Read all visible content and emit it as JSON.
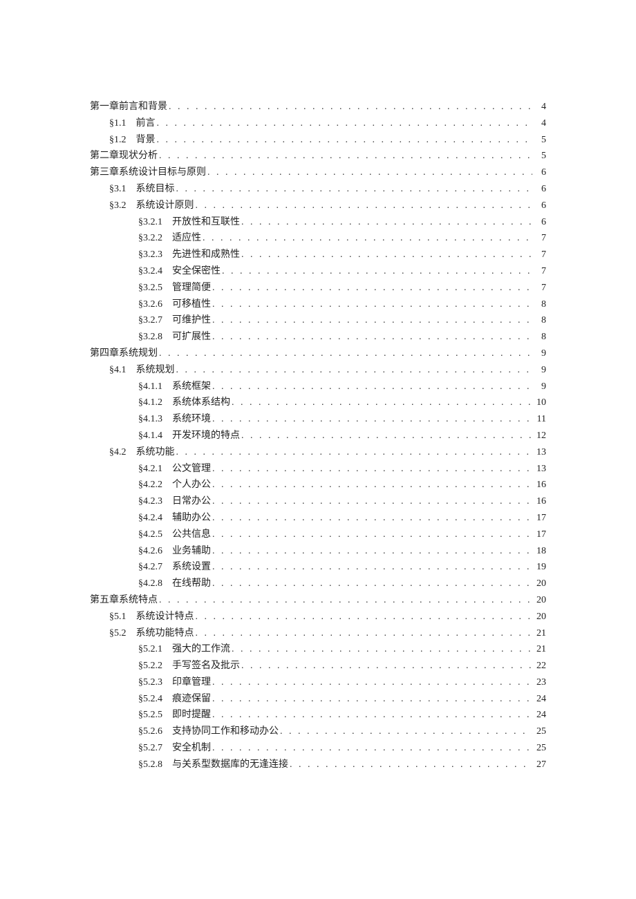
{
  "toc": [
    {
      "indent": 0,
      "num": "",
      "title": "第一章前言和背景",
      "page": "4"
    },
    {
      "indent": 1,
      "num": "§1.1",
      "title": "前言",
      "page": "4"
    },
    {
      "indent": 1,
      "num": "§1.2",
      "title": "背景",
      "page": "5"
    },
    {
      "indent": 0,
      "num": "",
      "title": "第二章现状分析",
      "page": "5"
    },
    {
      "indent": 0,
      "num": "",
      "title": "第三章系统设计目标与原则",
      "page": "6"
    },
    {
      "indent": 1,
      "num": "§3.1",
      "title": "系统目标",
      "page": "6"
    },
    {
      "indent": 1,
      "num": "§3.2",
      "title": "系统设计原则",
      "page": "6"
    },
    {
      "indent": 2,
      "num": "§3.2.1",
      "title": "开放性和互联性",
      "page": "6"
    },
    {
      "indent": 2,
      "num": "§3.2.2",
      "title": "适应性",
      "page": "7"
    },
    {
      "indent": 2,
      "num": "§3.2.3",
      "title": "先进性和成熟性",
      "page": "7"
    },
    {
      "indent": 2,
      "num": "§3.2.4",
      "title": "安全保密性",
      "page": "7"
    },
    {
      "indent": 2,
      "num": "§3.2.5",
      "title": "管理简便",
      "page": "7"
    },
    {
      "indent": 2,
      "num": "§3.2.6",
      "title": "可移植性",
      "page": "8"
    },
    {
      "indent": 2,
      "num": "§3.2.7",
      "title": "可维护性",
      "page": "8"
    },
    {
      "indent": 2,
      "num": "§3.2.8",
      "title": "可扩展性",
      "page": "8"
    },
    {
      "indent": 0,
      "num": "",
      "title": "第四章系统规划",
      "page": "9"
    },
    {
      "indent": 1,
      "num": "§4.1",
      "title": "系统规划",
      "page": "9"
    },
    {
      "indent": 2,
      "num": "§4.1.1",
      "title": "系统框架",
      "page": "9"
    },
    {
      "indent": 2,
      "num": "§4.1.2",
      "title": "系统体系结构",
      "page": "10"
    },
    {
      "indent": 2,
      "num": "§4.1.3",
      "title": "系统环境",
      "page": "11"
    },
    {
      "indent": 2,
      "num": "§4.1.4",
      "title": "开发环境的特点",
      "page": "12"
    },
    {
      "indent": 1,
      "num": "§4.2",
      "title": "系统功能",
      "page": "13"
    },
    {
      "indent": 2,
      "num": "§4.2.1",
      "title": "公文管理",
      "page": "13"
    },
    {
      "indent": 2,
      "num": "§4.2.2",
      "title": "个人办公",
      "page": "16"
    },
    {
      "indent": 2,
      "num": "§4.2.3",
      "title": "日常办公",
      "page": "16"
    },
    {
      "indent": 2,
      "num": "§4.2.4",
      "title": "辅助办公",
      "page": "17"
    },
    {
      "indent": 2,
      "num": "§4.2.5",
      "title": "公共信息",
      "page": "17"
    },
    {
      "indent": 2,
      "num": "§4.2.6",
      "title": "业务辅助",
      "page": "18"
    },
    {
      "indent": 2,
      "num": "§4.2.7",
      "title": "系统设置",
      "page": "19"
    },
    {
      "indent": 2,
      "num": "§4.2.8",
      "title": "在线帮助",
      "page": "20"
    },
    {
      "indent": 0,
      "num": "",
      "title": "第五章系统特点",
      "page": "20"
    },
    {
      "indent": 1,
      "num": "§5.1",
      "title": "系统设计特点",
      "page": "20"
    },
    {
      "indent": 1,
      "num": "§5.2",
      "title": "系统功能特点",
      "page": "21"
    },
    {
      "indent": 2,
      "num": "§5.2.1",
      "title": "强大的工作流",
      "page": "21"
    },
    {
      "indent": 2,
      "num": "§5.2.2",
      "title": "手写签名及批示",
      "page": "22"
    },
    {
      "indent": 2,
      "num": "§5.2.3",
      "title": "印章管理",
      "page": "23"
    },
    {
      "indent": 2,
      "num": "§5.2.4",
      "title": "痕迹保留",
      "page": "24"
    },
    {
      "indent": 2,
      "num": "§5.2.5",
      "title": "即时提醒",
      "page": "24"
    },
    {
      "indent": 2,
      "num": "§5.2.6",
      "title": "支持协同工作和移动办公",
      "page": "25"
    },
    {
      "indent": 2,
      "num": "§5.2.7",
      "title": "安全机制",
      "page": "25"
    },
    {
      "indent": 2,
      "num": "§5.2.8",
      "title": "与关系型数据库的无逢连接",
      "page": "27"
    }
  ]
}
